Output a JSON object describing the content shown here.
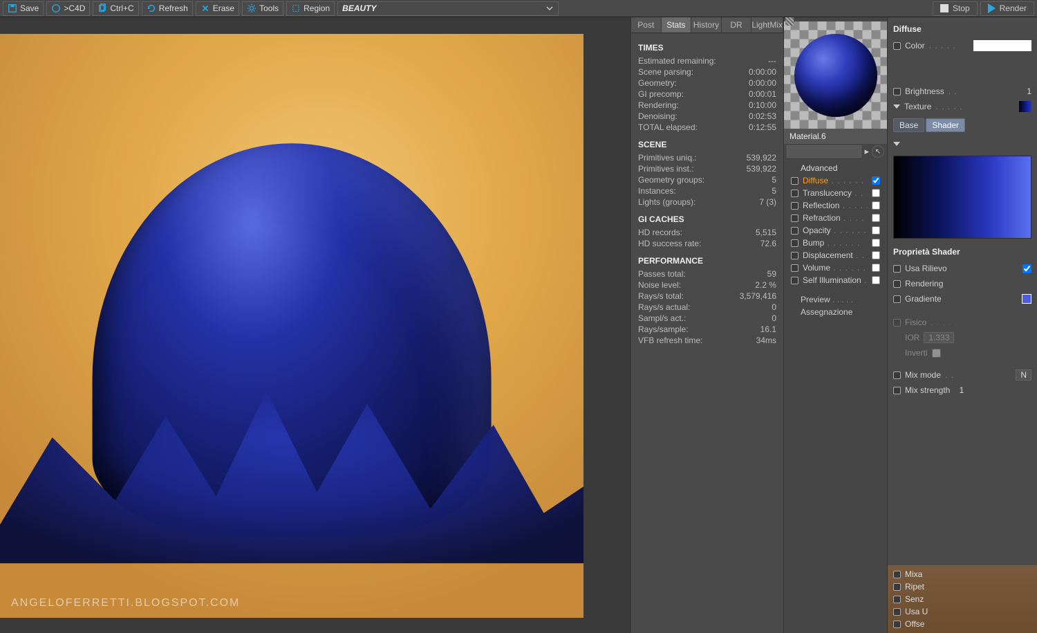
{
  "toolbar": {
    "save": "Save",
    "c4d": ">C4D",
    "copy": "Ctrl+C",
    "refresh": "Refresh",
    "erase": "Erase",
    "tools": "Tools",
    "region": "Region",
    "passname": "BEAUTY",
    "stop": "Stop",
    "render": "Render"
  },
  "watermark": "ANGELOFERRETTI.BLOGSPOT.COM",
  "vfb": {
    "tabs": {
      "post": "Post",
      "stats": "Stats",
      "history": "History",
      "dr": "DR",
      "lightmix": "LightMix"
    },
    "times": {
      "header": "TIMES",
      "rows": [
        {
          "k": "Estimated remaining:",
          "v": "---"
        },
        {
          "k": "Scene parsing:",
          "v": "0:00:00"
        },
        {
          "k": "Geometry:",
          "v": "0:00:00"
        },
        {
          "k": "GI precomp:",
          "v": "0:00:01"
        },
        {
          "k": "Rendering:",
          "v": "0:10:00"
        },
        {
          "k": "Denoising:",
          "v": "0:02:53"
        },
        {
          "k": "TOTAL elapsed:",
          "v": "0:12:55"
        }
      ]
    },
    "scene": {
      "header": "SCENE",
      "rows": [
        {
          "k": "Primitives uniq.:",
          "v": "539,922"
        },
        {
          "k": "Primitives inst.:",
          "v": "539,922"
        },
        {
          "k": "Geometry groups:",
          "v": "5"
        },
        {
          "k": "Instances:",
          "v": "5"
        },
        {
          "k": "Lights (groups):",
          "v": "7 (3)"
        }
      ]
    },
    "gi": {
      "header": "GI CACHES",
      "rows": [
        {
          "k": "HD records:",
          "v": "5,515"
        },
        {
          "k": "HD success rate:",
          "v": "72.6"
        }
      ]
    },
    "perf": {
      "header": "PERFORMANCE",
      "rows": [
        {
          "k": "Passes total:",
          "v": "59"
        },
        {
          "k": "Noise level:",
          "v": "2.2 %"
        },
        {
          "k": "Rays/s total:",
          "v": "3,579,416"
        },
        {
          "k": "Rays/s actual:",
          "v": "0"
        },
        {
          "k": "Sampl/s act.:",
          "v": "0"
        },
        {
          "k": "Rays/sample:",
          "v": "16.1"
        },
        {
          "k": "VFB refresh time:",
          "v": "34ms"
        }
      ]
    }
  },
  "material": {
    "name": "Material.6",
    "advanced": "Advanced",
    "channels": [
      {
        "label": "Diffuse",
        "checked": true,
        "active": true
      },
      {
        "label": "Translucency",
        "checked": false
      },
      {
        "label": "Reflection",
        "checked": false
      },
      {
        "label": "Refraction",
        "checked": false
      },
      {
        "label": "Opacity",
        "checked": false
      },
      {
        "label": "Bump",
        "checked": false
      },
      {
        "label": "Displacement",
        "checked": false
      },
      {
        "label": "Volume",
        "checked": false
      },
      {
        "label": "Self Illumination",
        "checked": false
      }
    ],
    "preview": "Preview",
    "assign": "Assegnazione"
  },
  "prop": {
    "diffuse": "Diffuse",
    "color": "Color",
    "brightness": "Brightness",
    "brightness_val": "1",
    "texture": "Texture",
    "tabs": {
      "base": "Base",
      "shader": "Shader"
    },
    "shaderprops": "Proprietà Shader",
    "usa": "Usa Rilievo",
    "rendering": "Rendering",
    "gradiente": "Gradiente",
    "fisico": "Fisico",
    "ior": "IOR",
    "ior_val": "1.333",
    "inverti": "Inverti",
    "mixmode": "Mix mode",
    "mixmode_val": "N",
    "mixstr": "Mix strength",
    "mixstr_val": "1",
    "lower": [
      "Mixa",
      "Ripet",
      "Senz",
      "Usa U",
      "Offse"
    ]
  }
}
